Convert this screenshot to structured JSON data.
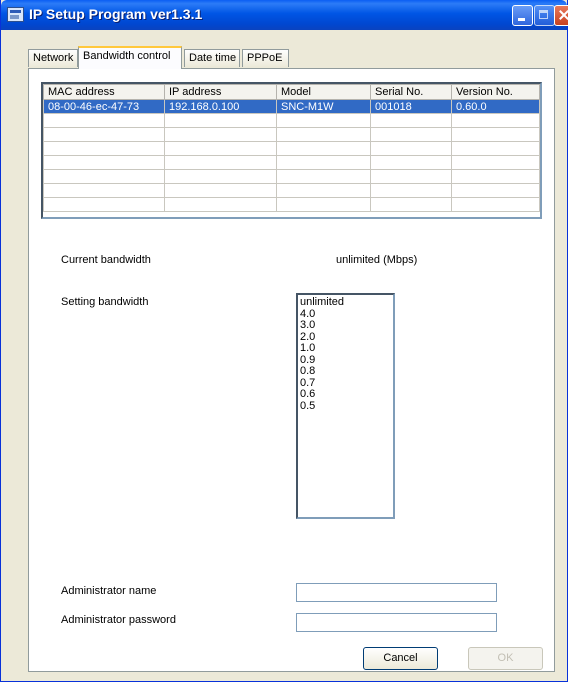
{
  "window": {
    "title": "IP Setup Program ver1.3.1"
  },
  "tabs": [
    {
      "label": "Network",
      "active": false
    },
    {
      "label": "Bandwidth control",
      "active": true
    },
    {
      "label": "Date time",
      "active": false
    },
    {
      "label": "PPPoE",
      "active": false
    }
  ],
  "table": {
    "columns": [
      "MAC address",
      "IP address",
      "Model",
      "Serial No.",
      "Version No."
    ],
    "rows": [
      [
        "08-00-46-ec-47-73",
        "192.168.0.100",
        "SNC-M1W",
        "001018",
        "0.60.0"
      ]
    ],
    "selected_row": 0,
    "empty_rows": 7
  },
  "current_bandwidth": {
    "label": "Current bandwidth",
    "value": "unlimited  (Mbps)"
  },
  "setting_bandwidth": {
    "label": "Setting bandwidth",
    "options": [
      "unlimited",
      "4.0",
      "3.0",
      "2.0",
      "1.0",
      "0.9",
      "0.8",
      "0.7",
      "0.6",
      "0.5"
    ]
  },
  "admin": {
    "name_label": "Administrator name",
    "name_value": "",
    "password_label": "Administrator password",
    "password_value": ""
  },
  "buttons": {
    "cancel": "Cancel",
    "ok": "OK"
  },
  "colors": {
    "selection": "#316ac5",
    "titlebar": "#0055e5",
    "active_tab_accent": "#ffc83c"
  }
}
